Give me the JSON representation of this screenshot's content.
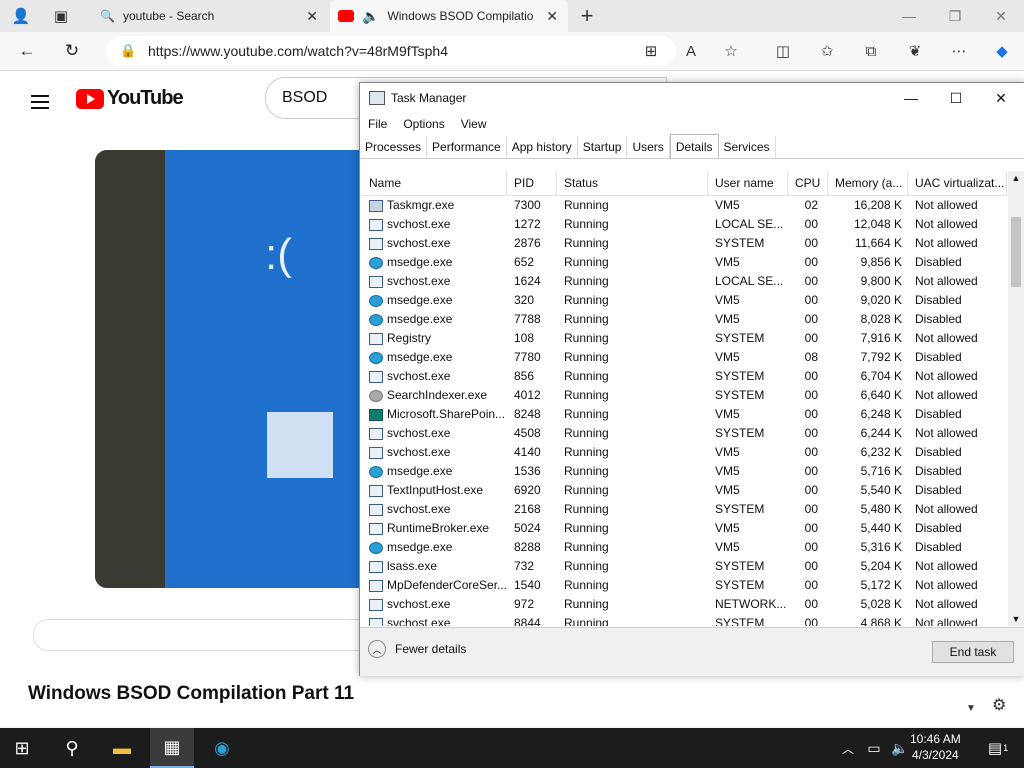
{
  "browser": {
    "tabs": [
      {
        "title": "youtube - Search"
      },
      {
        "title": "Windows BSOD Compilatio"
      }
    ],
    "url": "https://www.youtube.com/watch?v=48rM9fTsph4"
  },
  "youtube": {
    "logo_text": "YouTube",
    "search_value": "BSOD",
    "video_title": "Windows BSOD Compilation Part 11"
  },
  "task_manager": {
    "title": "Task Manager",
    "menu": [
      "File",
      "Options",
      "View"
    ],
    "tabs": [
      "Processes",
      "Performance",
      "App history",
      "Startup",
      "Users",
      "Details",
      "Services"
    ],
    "active_tab": "Details",
    "columns": [
      "Name",
      "PID",
      "Status",
      "User name",
      "CPU",
      "Memory (a...",
      "UAC virtualizat..."
    ],
    "rows": [
      {
        "icon": "gear",
        "name": "Taskmgr.exe",
        "pid": "7300",
        "status": "Running",
        "user": "VM5",
        "cpu": "02",
        "mem": "16,208 K",
        "uac": "Not allowed"
      },
      {
        "icon": "win",
        "name": "svchost.exe",
        "pid": "1272",
        "status": "Running",
        "user": "LOCAL SE...",
        "cpu": "00",
        "mem": "12,048 K",
        "uac": "Not allowed"
      },
      {
        "icon": "win",
        "name": "svchost.exe",
        "pid": "2876",
        "status": "Running",
        "user": "SYSTEM",
        "cpu": "00",
        "mem": "11,664 K",
        "uac": "Not allowed"
      },
      {
        "icon": "edge",
        "name": "msedge.exe",
        "pid": "652",
        "status": "Running",
        "user": "VM5",
        "cpu": "00",
        "mem": "9,856 K",
        "uac": "Disabled"
      },
      {
        "icon": "win",
        "name": "svchost.exe",
        "pid": "1624",
        "status": "Running",
        "user": "LOCAL SE...",
        "cpu": "00",
        "mem": "9,800 K",
        "uac": "Not allowed"
      },
      {
        "icon": "edge",
        "name": "msedge.exe",
        "pid": "320",
        "status": "Running",
        "user": "VM5",
        "cpu": "00",
        "mem": "9,020 K",
        "uac": "Disabled"
      },
      {
        "icon": "edge",
        "name": "msedge.exe",
        "pid": "7788",
        "status": "Running",
        "user": "VM5",
        "cpu": "00",
        "mem": "8,028 K",
        "uac": "Disabled"
      },
      {
        "icon": "win",
        "name": "Registry",
        "pid": "108",
        "status": "Running",
        "user": "SYSTEM",
        "cpu": "00",
        "mem": "7,916 K",
        "uac": "Not allowed"
      },
      {
        "icon": "edge",
        "name": "msedge.exe",
        "pid": "7780",
        "status": "Running",
        "user": "VM5",
        "cpu": "08",
        "mem": "7,792 K",
        "uac": "Disabled"
      },
      {
        "icon": "win",
        "name": "svchost.exe",
        "pid": "856",
        "status": "Running",
        "user": "SYSTEM",
        "cpu": "00",
        "mem": "6,704 K",
        "uac": "Not allowed"
      },
      {
        "icon": "user",
        "name": "SearchIndexer.exe",
        "pid": "4012",
        "status": "Running",
        "user": "SYSTEM",
        "cpu": "00",
        "mem": "6,640 K",
        "uac": "Not allowed"
      },
      {
        "icon": "sp",
        "name": "Microsoft.SharePoin...",
        "pid": "8248",
        "status": "Running",
        "user": "VM5",
        "cpu": "00",
        "mem": "6,248 K",
        "uac": "Disabled"
      },
      {
        "icon": "win",
        "name": "svchost.exe",
        "pid": "4508",
        "status": "Running",
        "user": "SYSTEM",
        "cpu": "00",
        "mem": "6,244 K",
        "uac": "Not allowed"
      },
      {
        "icon": "win",
        "name": "svchost.exe",
        "pid": "4140",
        "status": "Running",
        "user": "VM5",
        "cpu": "00",
        "mem": "6,232 K",
        "uac": "Disabled"
      },
      {
        "icon": "edge",
        "name": "msedge.exe",
        "pid": "1536",
        "status": "Running",
        "user": "VM5",
        "cpu": "00",
        "mem": "5,716 K",
        "uac": "Disabled"
      },
      {
        "icon": "win",
        "name": "TextInputHost.exe",
        "pid": "6920",
        "status": "Running",
        "user": "VM5",
        "cpu": "00",
        "mem": "5,540 K",
        "uac": "Disabled"
      },
      {
        "icon": "win",
        "name": "svchost.exe",
        "pid": "2168",
        "status": "Running",
        "user": "SYSTEM",
        "cpu": "00",
        "mem": "5,480 K",
        "uac": "Not allowed"
      },
      {
        "icon": "win",
        "name": "RuntimeBroker.exe",
        "pid": "5024",
        "status": "Running",
        "user": "VM5",
        "cpu": "00",
        "mem": "5,440 K",
        "uac": "Disabled"
      },
      {
        "icon": "edge",
        "name": "msedge.exe",
        "pid": "8288",
        "status": "Running",
        "user": "VM5",
        "cpu": "00",
        "mem": "5,316 K",
        "uac": "Disabled"
      },
      {
        "icon": "win",
        "name": "lsass.exe",
        "pid": "732",
        "status": "Running",
        "user": "SYSTEM",
        "cpu": "00",
        "mem": "5,204 K",
        "uac": "Not allowed"
      },
      {
        "icon": "win",
        "name": "MpDefenderCoreSer...",
        "pid": "1540",
        "status": "Running",
        "user": "SYSTEM",
        "cpu": "00",
        "mem": "5,172 K",
        "uac": "Not allowed"
      },
      {
        "icon": "win",
        "name": "svchost.exe",
        "pid": "972",
        "status": "Running",
        "user": "NETWORK...",
        "cpu": "00",
        "mem": "5,028 K",
        "uac": "Not allowed"
      },
      {
        "icon": "win",
        "name": "svchost.exe",
        "pid": "8844",
        "status": "Running",
        "user": "SYSTEM",
        "cpu": "00",
        "mem": "4,868 K",
        "uac": "Not allowed"
      }
    ],
    "fewer_details_label": "Fewer details",
    "end_task_label": "End task"
  },
  "taskbar": {
    "time": "10:46 AM",
    "date": "4/3/2024",
    "notification_count": "1"
  }
}
